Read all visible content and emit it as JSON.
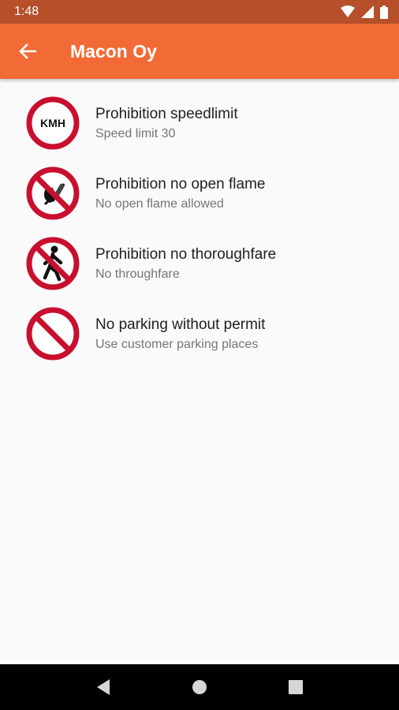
{
  "status_bar": {
    "time": "1:48",
    "icons": [
      "wifi-icon",
      "signal-icon",
      "battery-icon"
    ]
  },
  "app_bar": {
    "title": "Macon Oy",
    "back_icon": "arrow-left-icon"
  },
  "signs": [
    {
      "icon": "speed-limit-sign-icon",
      "sign_text": "KMH",
      "title": "Prohibition speedlimit",
      "subtitle": "Speed limit 30"
    },
    {
      "icon": "no-open-flame-sign-icon",
      "title": "Prohibition no open flame",
      "subtitle": "No open flame allowed"
    },
    {
      "icon": "no-thoroughfare-sign-icon",
      "title": "Prohibition no thoroughfare",
      "subtitle": "No throughfare"
    },
    {
      "icon": "no-parking-sign-icon",
      "title": "No parking without permit",
      "subtitle": "Use customer parking places"
    }
  ],
  "nav_bar": {
    "icons": [
      "back-triangle-icon",
      "home-circle-icon",
      "recents-square-icon"
    ]
  },
  "colors": {
    "status_bar": "#b5502a",
    "app_bar": "#f26a35",
    "sign_red": "#c8102e",
    "background": "#fafafa"
  }
}
